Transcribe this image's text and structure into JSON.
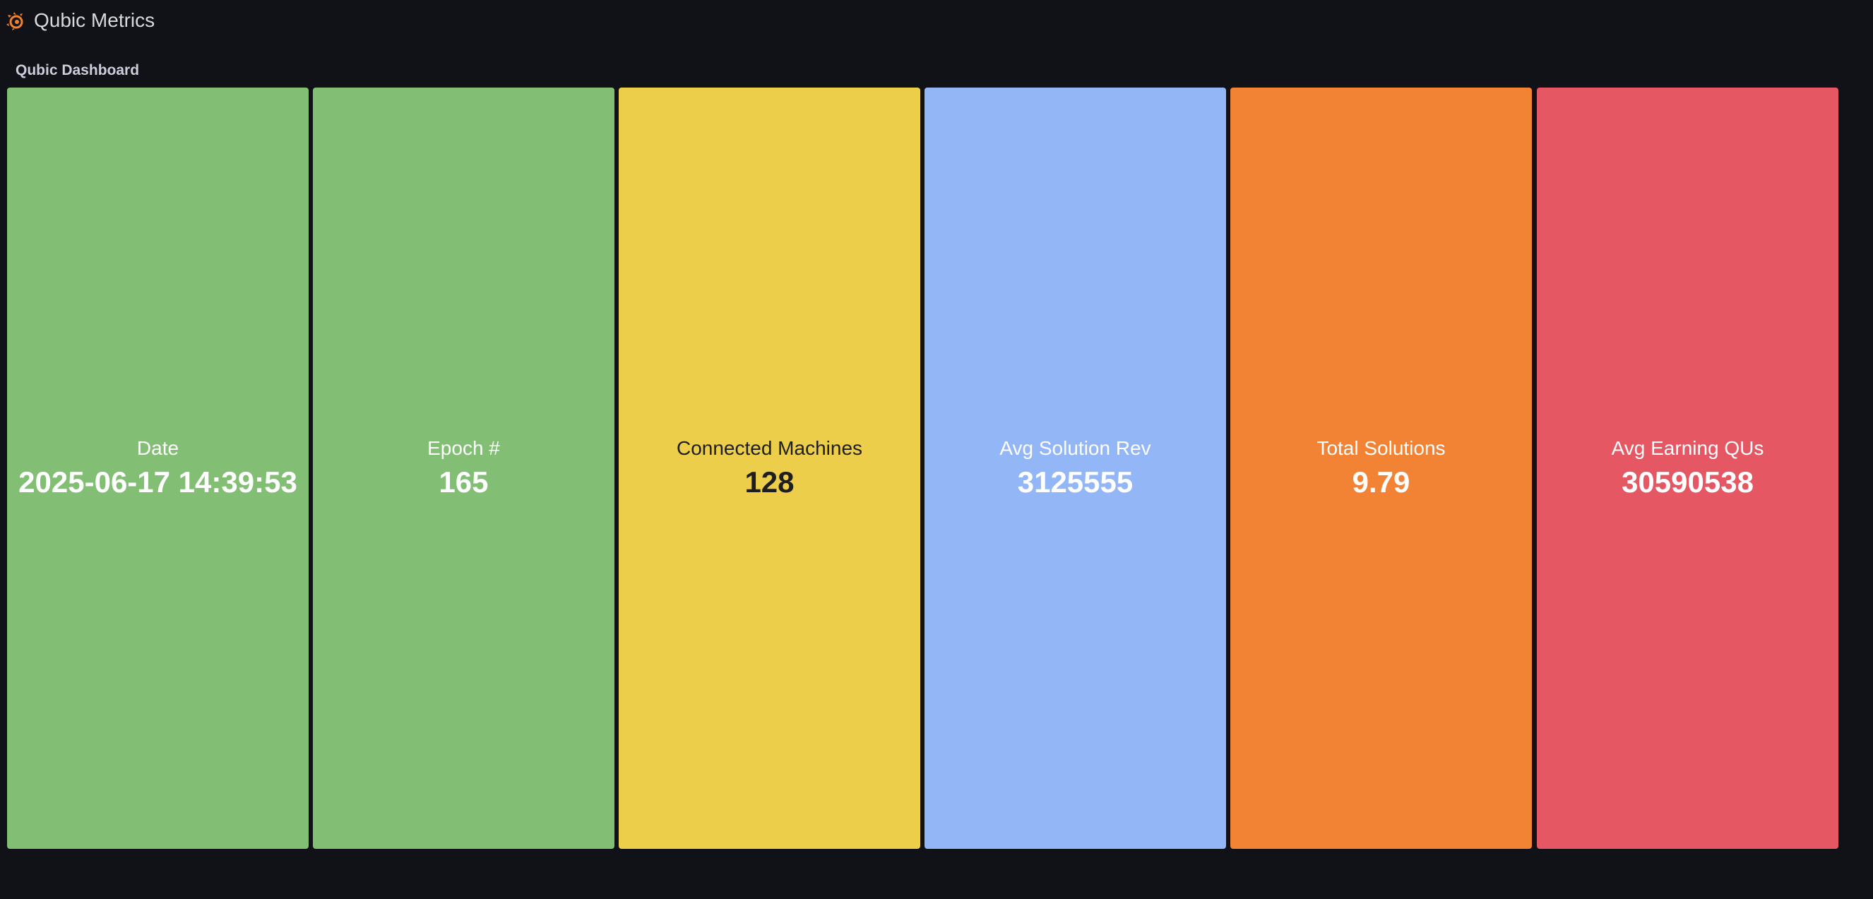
{
  "app": {
    "title": "Qubic Metrics",
    "logo_icon": "grafana-logo-icon",
    "logo_color": "#F2822E"
  },
  "dashboard": {
    "title": "Qubic Dashboard"
  },
  "panels": [
    {
      "label": "Date",
      "value": "2025-06-17 14:39:53",
      "bg": "#82BE74",
      "fg": "#FFFFFF"
    },
    {
      "label": "Epoch #",
      "value": "165",
      "bg": "#82BE74",
      "fg": "#FFFFFF"
    },
    {
      "label": "Connected Machines",
      "value": "128",
      "bg": "#ECCE4A",
      "fg": "#1E1E1E"
    },
    {
      "label": "Avg Solution Rev",
      "value": "3125555",
      "bg": "#93B6F7",
      "fg": "#FFFFFF"
    },
    {
      "label": "Total Solutions",
      "value": "9.79",
      "bg": "#F28234",
      "fg": "#FFFFFF"
    },
    {
      "label": "Avg Earning QUs",
      "value": "30590538",
      "bg": "#E45763",
      "fg": "#FFFFFF"
    }
  ]
}
